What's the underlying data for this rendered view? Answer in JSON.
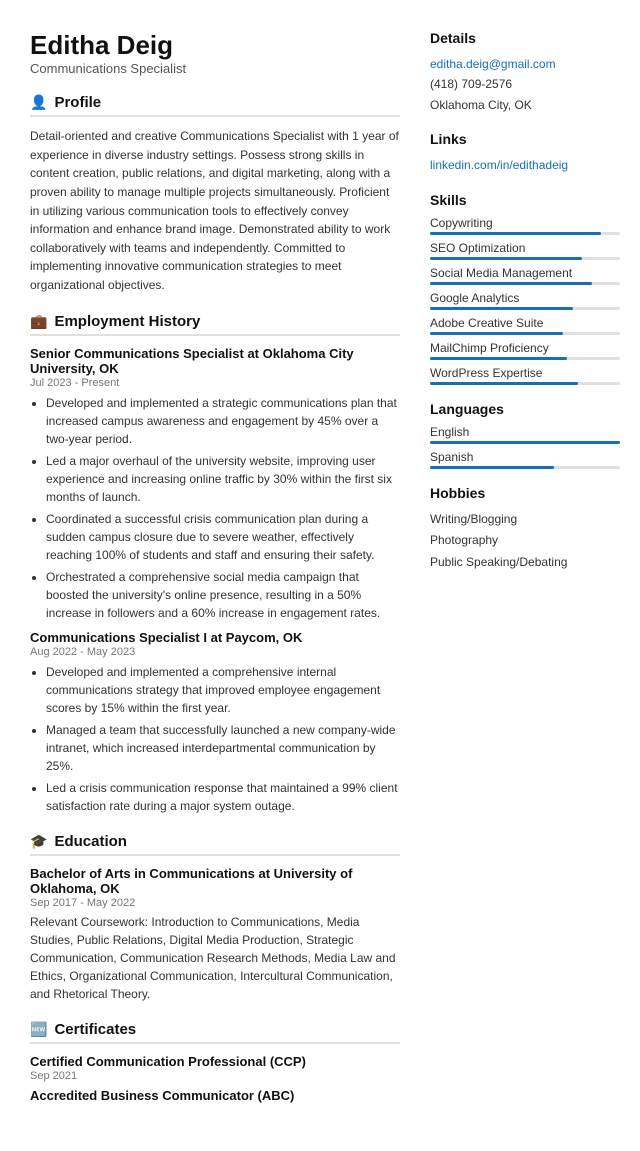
{
  "header": {
    "name": "Editha Deig",
    "title": "Communications Specialist"
  },
  "sections": {
    "profile": {
      "label": "Profile",
      "icon": "👤",
      "text": "Detail-oriented and creative Communications Specialist with 1 year of experience in diverse industry settings. Possess strong skills in content creation, public relations, and digital marketing, along with a proven ability to manage multiple projects simultaneously. Proficient in utilizing various communication tools to effectively convey information and enhance brand image. Demonstrated ability to work collaboratively with teams and independently. Committed to implementing innovative communication strategies to meet organizational objectives."
    },
    "employment": {
      "label": "Employment History",
      "icon": "💼",
      "jobs": [
        {
          "title": "Senior Communications Specialist at Oklahoma City University, OK",
          "date": "Jul 2023 - Present",
          "bullets": [
            "Developed and implemented a strategic communications plan that increased campus awareness and engagement by 45% over a two-year period.",
            "Led a major overhaul of the university website, improving user experience and increasing online traffic by 30% within the first six months of launch.",
            "Coordinated a successful crisis communication plan during a sudden campus closure due to severe weather, effectively reaching 100% of students and staff and ensuring their safety.",
            "Orchestrated a comprehensive social media campaign that boosted the university's online presence, resulting in a 50% increase in followers and a 60% increase in engagement rates."
          ]
        },
        {
          "title": "Communications Specialist I at Paycom, OK",
          "date": "Aug 2022 - May 2023",
          "bullets": [
            "Developed and implemented a comprehensive internal communications strategy that improved employee engagement scores by 15% within the first year.",
            "Managed a team that successfully launched a new company-wide intranet, which increased interdepartmental communication by 25%.",
            "Led a crisis communication response that maintained a 99% client satisfaction rate during a major system outage."
          ]
        }
      ]
    },
    "education": {
      "label": "Education",
      "icon": "🎓",
      "entries": [
        {
          "title": "Bachelor of Arts in Communications at University of Oklahoma, OK",
          "date": "Sep 2017 - May 2022",
          "text": "Relevant Coursework: Introduction to Communications, Media Studies, Public Relations, Digital Media Production, Strategic Communication, Communication Research Methods, Media Law and Ethics, Organizational Communication, Intercultural Communication, and Rhetorical Theory."
        }
      ]
    },
    "certificates": {
      "label": "Certificates",
      "icon": "🏅",
      "entries": [
        {
          "title": "Certified Communication Professional (CCP)",
          "date": "Sep 2021"
        },
        {
          "title": "Accredited Business Communicator (ABC)",
          "date": ""
        }
      ]
    }
  },
  "sidebar": {
    "details": {
      "label": "Details",
      "email": "editha.deig@gmail.com",
      "phone": "(418) 709-2576",
      "location": "Oklahoma City, OK"
    },
    "links": {
      "label": "Links",
      "items": [
        {
          "text": "linkedin.com/in/edithadeig",
          "url": "#"
        }
      ]
    },
    "skills": {
      "label": "Skills",
      "items": [
        {
          "name": "Copywriting",
          "pct": 90
        },
        {
          "name": "SEO Optimization",
          "pct": 80
        },
        {
          "name": "Social Media Management",
          "pct": 85
        },
        {
          "name": "Google Analytics",
          "pct": 75
        },
        {
          "name": "Adobe Creative Suite",
          "pct": 70
        },
        {
          "name": "MailChimp Proficiency",
          "pct": 72
        },
        {
          "name": "WordPress Expertise",
          "pct": 78
        }
      ]
    },
    "languages": {
      "label": "Languages",
      "items": [
        {
          "name": "English",
          "pct": 100
        },
        {
          "name": "Spanish",
          "pct": 65
        }
      ]
    },
    "hobbies": {
      "label": "Hobbies",
      "items": [
        "Writing/Blogging",
        "Photography",
        "Public Speaking/Debating"
      ]
    }
  }
}
